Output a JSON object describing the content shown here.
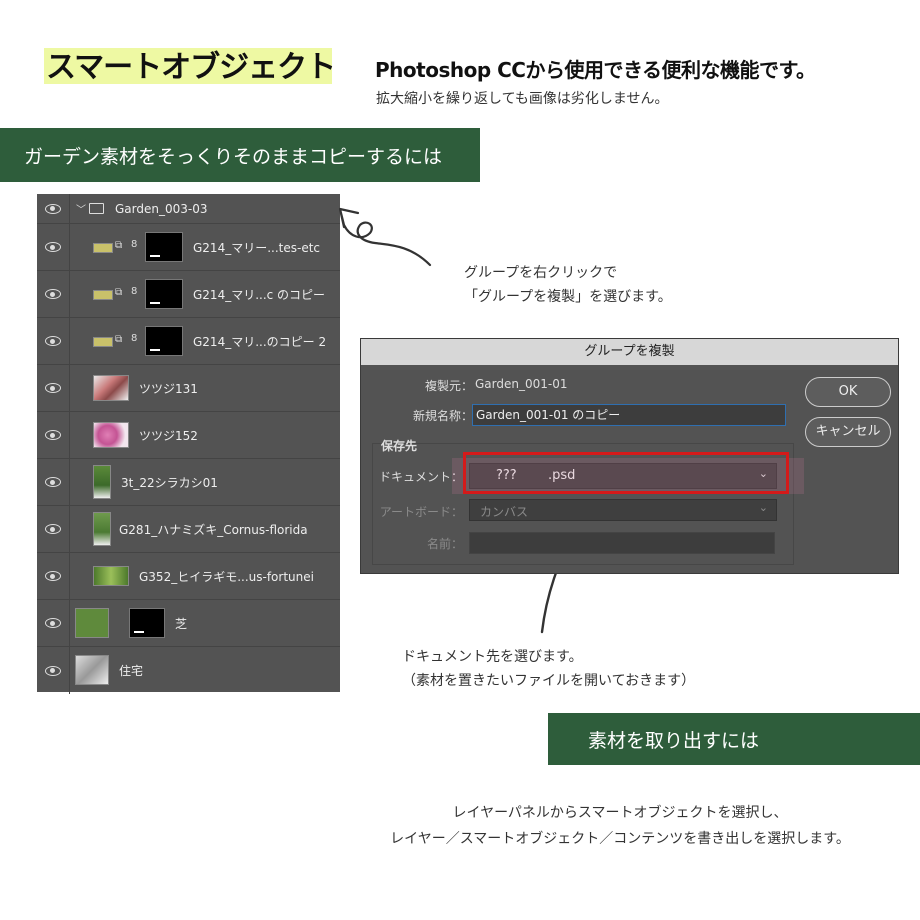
{
  "title": {
    "main": "スマートオブジェクト",
    "headline": "Photoshop CCから使用できる便利な機能です。",
    "subline": "拡大縮小を繰り返しても画像は劣化しません。"
  },
  "banners": {
    "copy_section": "ガーデン素材をそっくりそのままコピーするには",
    "extract_section": "素材を取り出すには"
  },
  "layers_panel": {
    "group_name": "Garden_003-03",
    "layers": [
      {
        "name": "G214_マリー...tes-etc",
        "type": "smart-mask"
      },
      {
        "name": "G214_マリ...c のコピー",
        "type": "smart-mask"
      },
      {
        "name": "G214_マリ...のコピー 2",
        "type": "smart-mask"
      },
      {
        "name": "ツツジ131",
        "type": "image"
      },
      {
        "name": "ツツジ152",
        "type": "image"
      },
      {
        "name": "3t_22シラカシ01",
        "type": "image"
      },
      {
        "name": "G281_ハナミズキ_Cornus-florida",
        "type": "image"
      },
      {
        "name": "G352_ヒイラギモ...us-fortunei",
        "type": "image"
      },
      {
        "name": "芝",
        "type": "image-mask"
      },
      {
        "name": "住宅",
        "type": "image"
      }
    ]
  },
  "annotations": {
    "right_click_line1": "グループを右クリックで",
    "right_click_line2": "「グループを複製」を選びます。",
    "document_line1": "ドキュメント先を選びます。",
    "document_line2": "（素材を置きたいファイルを開いておきます）"
  },
  "dialog": {
    "title": "グループを複製",
    "source_label": "複製元：",
    "source_value": "Garden_001-01",
    "new_name_label": "新規名称：",
    "new_name_value": "Garden_001-01 のコピー",
    "destination_group": "保存先",
    "document_label": "ドキュメント：",
    "document_value_placeholder": "???",
    "document_value_ext": ".psd",
    "artboard_label": "アートボード：",
    "artboard_value": "カンバス",
    "name_label": "名前：",
    "name_value": "",
    "ok_button": "OK",
    "cancel_button": "キャンセル",
    "highlight_color": "#d41a1a"
  },
  "bottom": {
    "line1": "レイヤーパネルからスマートオブジェクトを選択し、",
    "line2": "レイヤー／スマートオブジェクト／コンテンツを書き出しを選択します。"
  },
  "colors": {
    "banner_green": "#2e5d3b",
    "title_highlight": "#eef9a3",
    "panel_gray": "#535353"
  }
}
